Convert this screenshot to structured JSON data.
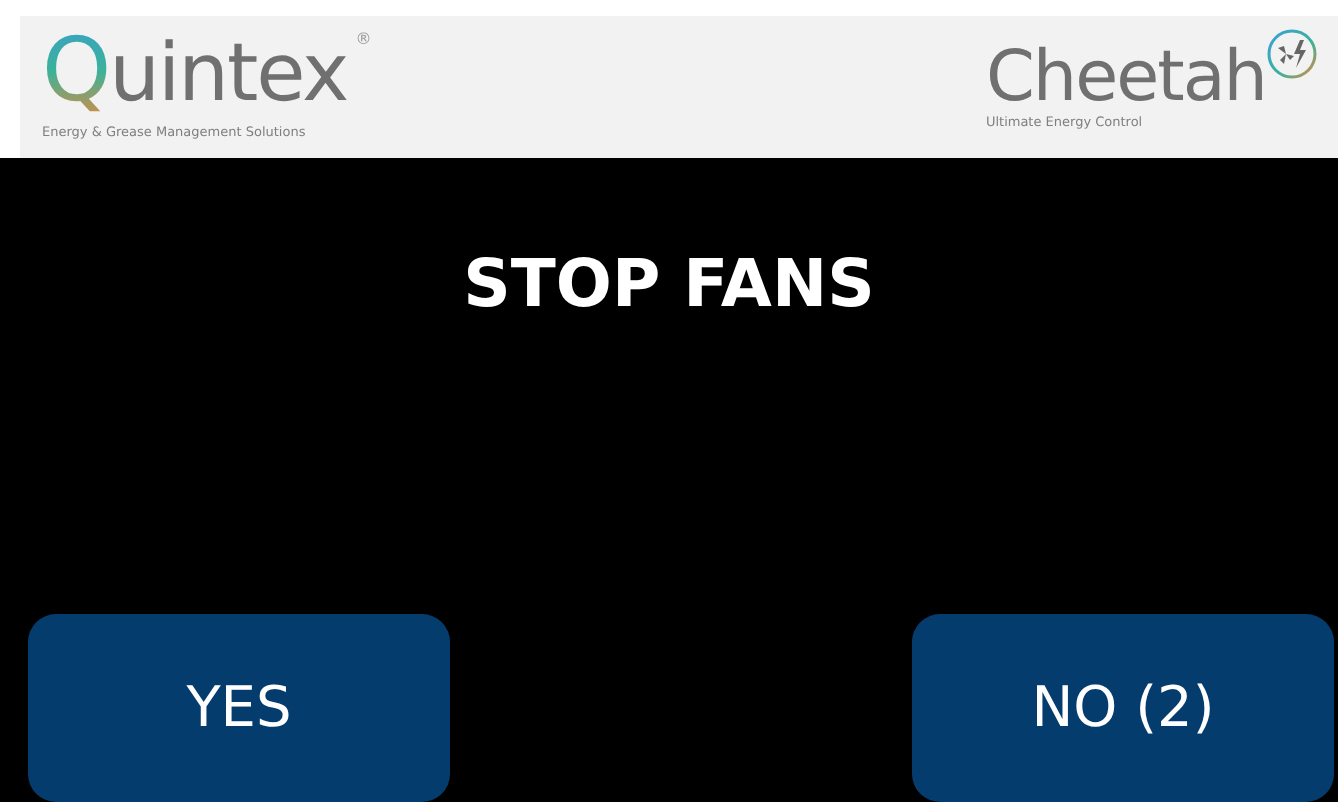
{
  "header": {
    "left_logo": {
      "name": "Quintex",
      "mark": "®",
      "tagline": "Energy & Grease Management Solutions"
    },
    "right_logo": {
      "name": "Cheetah",
      "tagline": "Ultimate Energy Control"
    }
  },
  "title": "STOP FANS",
  "buttons": [
    {
      "label": "YES"
    },
    {
      "label": "NO (2)"
    }
  ]
}
